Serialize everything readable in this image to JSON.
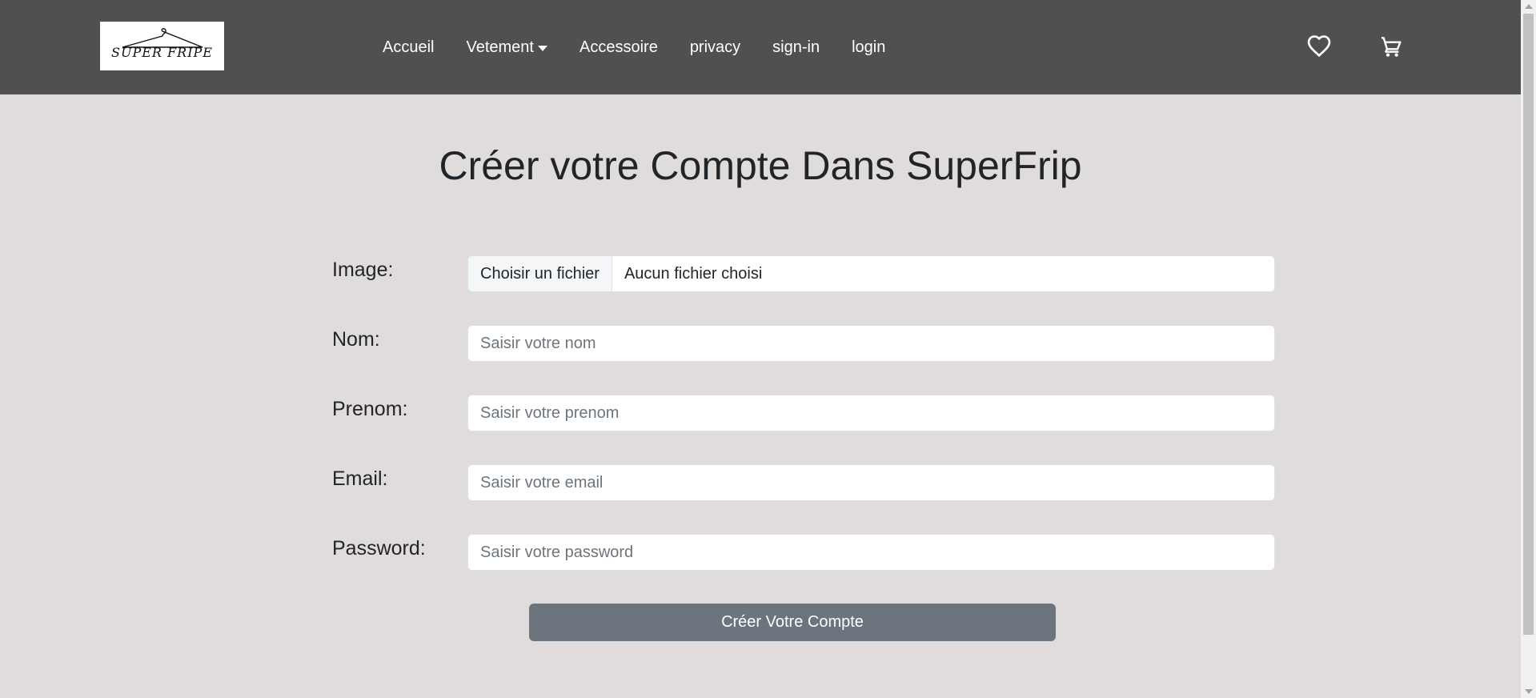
{
  "navbar": {
    "logo_text": "SUPER FRIPE",
    "links": [
      {
        "label": "Accueil"
      },
      {
        "label": "Vetement",
        "has_dropdown": true
      },
      {
        "label": "Accessoire"
      },
      {
        "label": "privacy"
      },
      {
        "label": "sign-in"
      },
      {
        "label": "login"
      }
    ],
    "icons": [
      "heart-icon",
      "cart-icon"
    ],
    "background_color": "#505050"
  },
  "main": {
    "title": "Créer votre Compte Dans SuperFrip",
    "background_color": "#e1dcdc",
    "form": {
      "image": {
        "label": "Image:",
        "button_label": "Choisir un fichier",
        "status": "Aucun fichier choisi"
      },
      "nom": {
        "label": "Nom:",
        "placeholder": "Saisir votre nom",
        "value": ""
      },
      "prenom": {
        "label": "Prenom:",
        "placeholder": "Saisir votre prenom",
        "value": ""
      },
      "email": {
        "label": "Email:",
        "placeholder": "Saisir votre email",
        "value": ""
      },
      "password": {
        "label": "Password:",
        "placeholder": "Saisir votre password",
        "value": ""
      },
      "submit_label": "Créer Votre Compte",
      "submit_color": "#6c757d"
    }
  }
}
